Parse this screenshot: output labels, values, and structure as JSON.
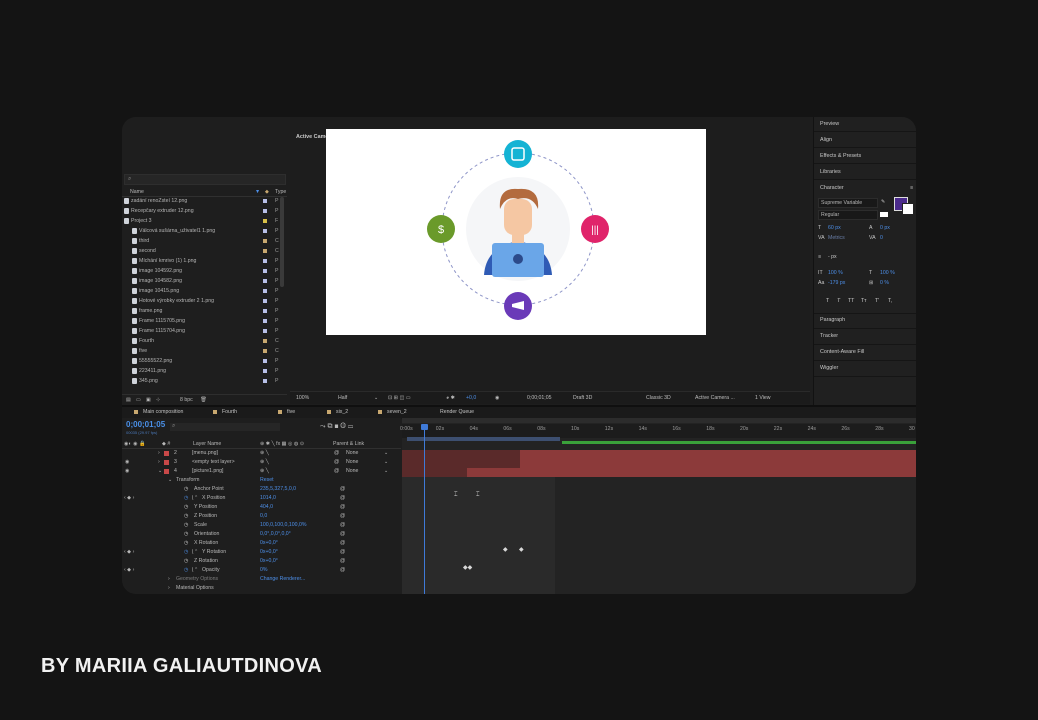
{
  "byline": "BY MARIIA GALIAUTDINOVA",
  "project": {
    "search_icon": "search-icon",
    "col_name": "Name",
    "col_type": "Type",
    "items": [
      {
        "label": "zadání renoZsteí 12.png",
        "color": "#b8c0e8",
        "type": "P",
        "indent": 0
      },
      {
        "label": "Recepčary extruder 12.png",
        "color": "#b8c0e8",
        "type": "P",
        "indent": 0
      },
      {
        "label": "Project 3",
        "color": "#d8c048",
        "type": "F",
        "indent": 0
      },
      {
        "label": "Válcová sušárna_uživatel1 1.png",
        "color": "#b8c0e8",
        "type": "P",
        "indent": 1
      },
      {
        "label": "third",
        "color": "#c8a870",
        "type": "C",
        "indent": 1
      },
      {
        "label": "second",
        "color": "#c8a870",
        "type": "C",
        "indent": 1
      },
      {
        "label": "Míchání kmrivo (1) 1.png",
        "color": "#b8c0e8",
        "type": "P",
        "indent": 1
      },
      {
        "label": "image 104592.png",
        "color": "#b8c0e8",
        "type": "P",
        "indent": 1
      },
      {
        "label": "image 104582.png",
        "color": "#b8c0e8",
        "type": "P",
        "indent": 1
      },
      {
        "label": "image 10415.png",
        "color": "#b8c0e8",
        "type": "P",
        "indent": 1
      },
      {
        "label": "Hotové výrobky extruder 2 1.png",
        "color": "#b8c0e8",
        "type": "P",
        "indent": 1
      },
      {
        "label": "frame.png",
        "color": "#b8c0e8",
        "type": "P",
        "indent": 1
      },
      {
        "label": "Frame 1115705.png",
        "color": "#b8c0e8",
        "type": "P",
        "indent": 1
      },
      {
        "label": "Frame 1115704.png",
        "color": "#b8c0e8",
        "type": "P",
        "indent": 1
      },
      {
        "label": "Fourth",
        "color": "#c8a870",
        "type": "C",
        "indent": 1
      },
      {
        "label": "five",
        "color": "#c8a870",
        "type": "C",
        "indent": 1
      },
      {
        "label": "55555522.png",
        "color": "#b8c0e8",
        "type": "P",
        "indent": 1
      },
      {
        "label": "223411.png",
        "color": "#b8c0e8",
        "type": "P",
        "indent": 1
      },
      {
        "label": "345.png",
        "color": "#b8c0e8",
        "type": "P",
        "indent": 1
      }
    ],
    "bpc": "8 bpc"
  },
  "viewer": {
    "label": "Active Camera (Default)",
    "zoom": "100%",
    "resolution": "Half",
    "exposure": "+0,0",
    "timecode": "0;00;01;05",
    "draft": "Draft 3D",
    "renderer": "Classic 3D",
    "camera": "Active Camera ...",
    "views": "1 View"
  },
  "right_panel": {
    "headers": [
      "Preview",
      "Align",
      "Effects & Presets",
      "Libraries",
      "Character"
    ],
    "font": "Supreme Variable",
    "style": "Regular",
    "size": "60 px",
    "leading": "0 px",
    "kerning": "Metrics",
    "tracking": "0",
    "stroke": "- px",
    "vscale": "100 %",
    "hscale": "100 %",
    "baseline": "-179 px",
    "tsume": "0 %",
    "type_buttons": [
      "T",
      "T",
      "TT",
      "Tт",
      "T'",
      "T,"
    ],
    "lower_headers": [
      "Paragraph",
      "Tracker",
      "Content-Aware Fill",
      "Wiggler"
    ],
    "fill_color": "#4a2a8c"
  },
  "tabs": [
    {
      "label": "Main composition",
      "color": "#c8a870"
    },
    {
      "label": "Fourth",
      "color": "#c8a870"
    },
    {
      "label": "five",
      "color": "#c8a870"
    },
    {
      "label": "six_2",
      "color": "#c8a870"
    },
    {
      "label": "seven_2",
      "color": "#c8a870"
    },
    {
      "label": "Render Queue",
      "color": ""
    }
  ],
  "timeline": {
    "timecode": "0;00;01;05",
    "timecode_sub": "00035 (29.97 fps)",
    "col_layer": "Layer Name",
    "col_parent": "Parent & Link",
    "layers": [
      {
        "num": "2",
        "name": "[menu.png]",
        "parent": "None",
        "color": "#c84848"
      },
      {
        "num": "3",
        "name": "<empty text layer>",
        "parent": "None",
        "color": "#c84848"
      },
      {
        "num": "4",
        "name": "[picture1.png]",
        "parent": "None",
        "color": "#c84848"
      }
    ],
    "transform": "Transform",
    "reset": "Reset",
    "properties": [
      {
        "name": "Anchor Point",
        "value": "235,5,327,5,0,0"
      },
      {
        "name": "X Position",
        "value": "1014,0"
      },
      {
        "name": "Y Position",
        "value": "404,0"
      },
      {
        "name": "Z Position",
        "value": "0,0"
      },
      {
        "name": "Scale",
        "value": "100,0,100,0,100,0%"
      },
      {
        "name": "Orientation",
        "value": "0,0°,0,0°,0,0°"
      },
      {
        "name": "X Rotation",
        "value": "0x+0,0°"
      },
      {
        "name": "Y Rotation",
        "value": "0x+0,0°"
      },
      {
        "name": "Z Rotation",
        "value": "0x+0,0°"
      },
      {
        "name": "Opacity",
        "value": "0%"
      }
    ],
    "geometry": "Geometry Options",
    "change_renderer": "Change Renderer...",
    "material": "Material Options",
    "ruler": [
      "0:00s",
      "02s",
      "04s",
      "06s",
      "08s",
      "10s",
      "12s",
      "14s",
      "16s",
      "18s",
      "20s",
      "22s",
      "24s",
      "26s",
      "28s",
      "30"
    ]
  }
}
